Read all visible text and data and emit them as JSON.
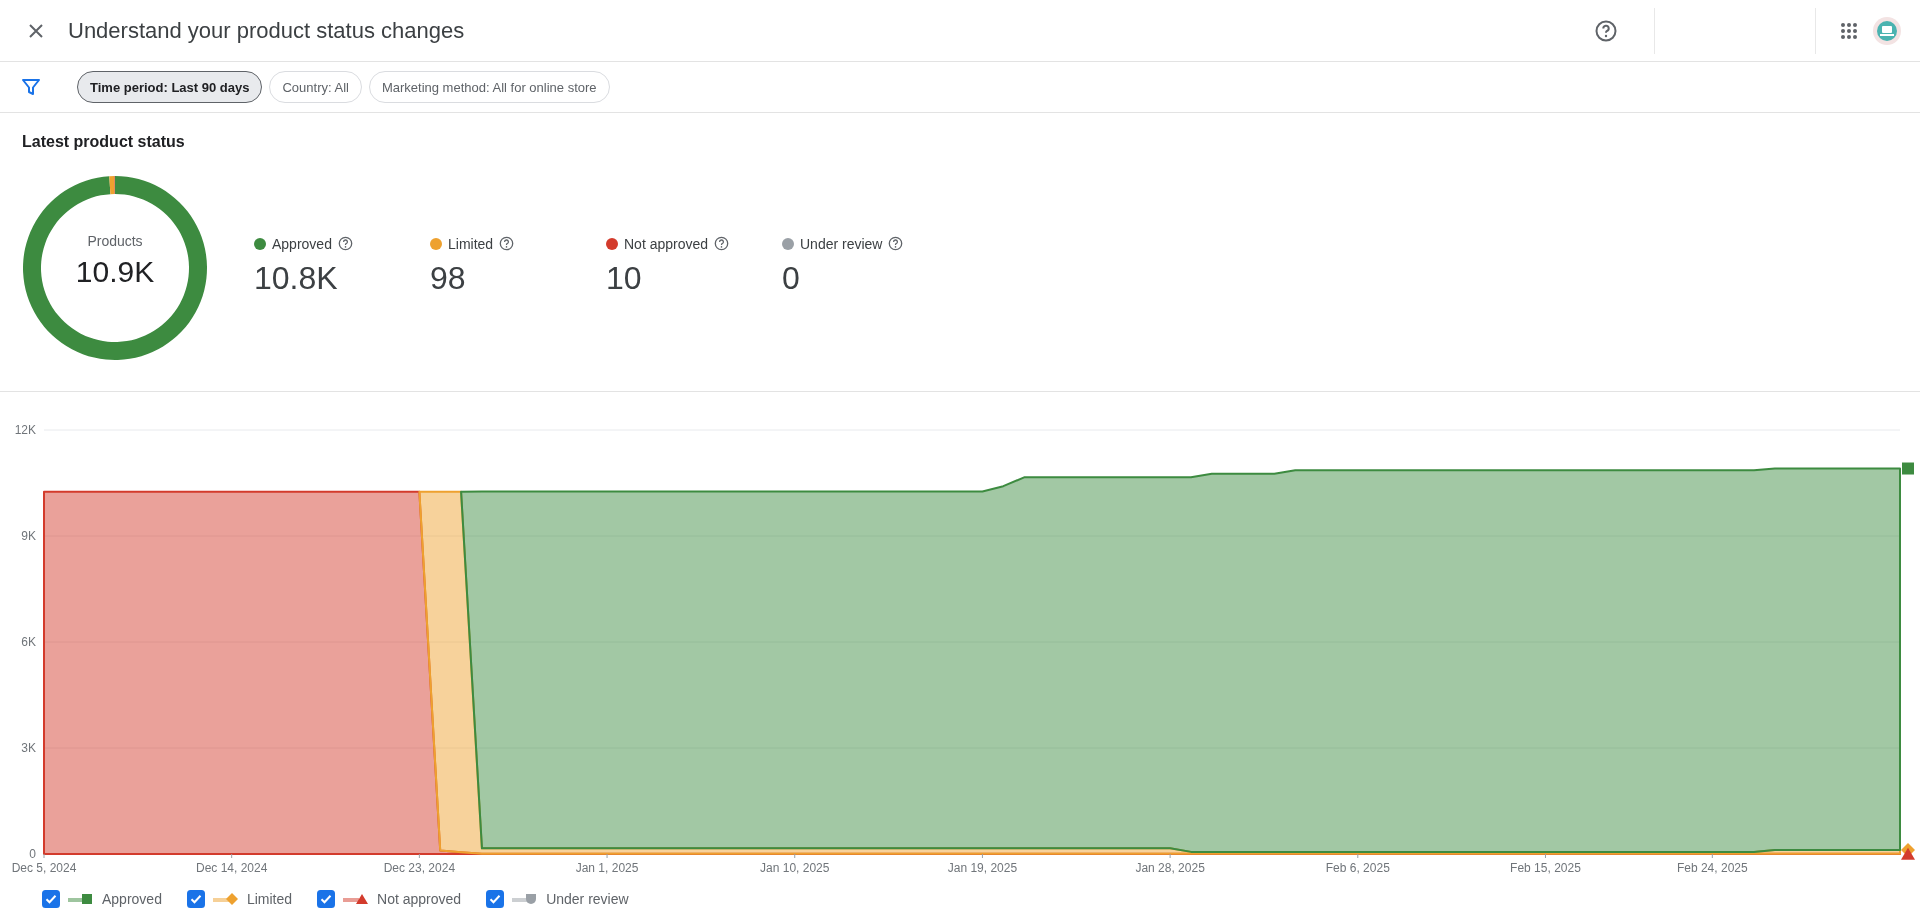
{
  "header": {
    "title": "Understand your product status changes"
  },
  "filters": [
    {
      "label": "Time period: Last 90 days",
      "selected": true
    },
    {
      "label": "Country: All",
      "selected": false
    },
    {
      "label": "Marketing method: All for online store",
      "selected": false
    }
  ],
  "summary": {
    "title": "Latest product status",
    "total_label": "Products",
    "total": "10.9K",
    "chart_data": {
      "type": "donut",
      "categories": [
        "Approved",
        "Limited",
        "Not approved",
        "Under review"
      ],
      "values": [
        99.01,
        0.9,
        0.09,
        0
      ]
    },
    "statuses": [
      {
        "value": "10.8K",
        "color": "#3d8b40"
      },
      {
        "value": "98",
        "color": "#eea12f"
      },
      {
        "value": "10",
        "color": "#d33b2c"
      },
      {
        "value": "0",
        "color": "#9aa0a6"
      }
    ]
  },
  "trend": {
    "chart_data": {
      "type": "area",
      "stacked": true,
      "grid": true,
      "categories": [
        "Dec 5, 2024",
        null,
        null,
        null,
        null,
        null,
        null,
        null,
        null,
        "Dec 14, 2024",
        null,
        null,
        null,
        null,
        null,
        null,
        null,
        null,
        "Dec 23, 2024",
        null,
        null,
        null,
        null,
        null,
        null,
        null,
        null,
        "Jan 1, 2025",
        null,
        null,
        null,
        null,
        null,
        null,
        null,
        null,
        "Jan 10, 2025",
        null,
        null,
        null,
        null,
        null,
        null,
        null,
        null,
        "Jan 19, 2025",
        null,
        null,
        null,
        null,
        null,
        null,
        null,
        null,
        "Jan 28, 2025",
        null,
        null,
        null,
        null,
        null,
        null,
        null,
        null,
        "Feb 6, 2025",
        null,
        null,
        null,
        null,
        null,
        null,
        null,
        null,
        "Feb 15, 2025",
        null,
        null,
        null,
        null,
        null,
        null,
        null,
        "Feb 24, 2025",
        null,
        null,
        null,
        null,
        null,
        null,
        null,
        null,
        null
      ],
      "series": [
        {
          "color": "#d33b2c",
          "values": [
            10250,
            10250,
            10250,
            10250,
            10250,
            10250,
            10250,
            10250,
            10250,
            10250,
            10250,
            10250,
            10250,
            10250,
            10250,
            10250,
            10250,
            10250,
            10250,
            100,
            50,
            10,
            10,
            10,
            10,
            10,
            10,
            10,
            10,
            10,
            10,
            10,
            10,
            10,
            10,
            10,
            10,
            10,
            10,
            10,
            10,
            10,
            10,
            10,
            10,
            10,
            10,
            10,
            10,
            10,
            10,
            10,
            10,
            10,
            10,
            10,
            10,
            10,
            10,
            10,
            10,
            10,
            10,
            10,
            10,
            10,
            10,
            10,
            10,
            10,
            10,
            10,
            10,
            10,
            10,
            10,
            10,
            10,
            10,
            10,
            10,
            10,
            10,
            10,
            10,
            10,
            10,
            10,
            10,
            10
          ]
        },
        {
          "color": "#eea12f",
          "values": [
            null,
            null,
            null,
            null,
            null,
            null,
            null,
            null,
            null,
            null,
            null,
            null,
            null,
            null,
            null,
            null,
            null,
            null,
            0,
            10150,
            10200,
            150,
            150,
            150,
            150,
            150,
            150,
            150,
            150,
            150,
            150,
            150,
            150,
            150,
            150,
            150,
            150,
            150,
            150,
            150,
            150,
            150,
            150,
            150,
            150,
            150,
            150,
            150,
            150,
            150,
            150,
            150,
            150,
            150,
            150,
            50,
            50,
            50,
            50,
            50,
            50,
            50,
            50,
            50,
            50,
            50,
            50,
            50,
            50,
            50,
            50,
            50,
            50,
            50,
            50,
            50,
            50,
            50,
            50,
            50,
            50,
            50,
            50,
            100,
            100,
            100,
            100,
            100,
            100,
            100
          ]
        },
        {
          "color": "#3d8b40",
          "values": [
            null,
            null,
            null,
            null,
            null,
            null,
            null,
            null,
            null,
            null,
            null,
            null,
            null,
            null,
            null,
            null,
            null,
            null,
            null,
            null,
            0,
            10100,
            10100,
            10100,
            10100,
            10100,
            10100,
            10100,
            10100,
            10100,
            10100,
            10100,
            10100,
            10100,
            10100,
            10100,
            10100,
            10100,
            10100,
            10100,
            10100,
            10100,
            10100,
            10100,
            10100,
            10100,
            10250,
            10500,
            10500,
            10500,
            10500,
            10500,
            10500,
            10500,
            10500,
            10600,
            10700,
            10700,
            10700,
            10700,
            10800,
            10800,
            10800,
            10800,
            10800,
            10800,
            10800,
            10800,
            10800,
            10800,
            10800,
            10800,
            10800,
            10800,
            10800,
            10800,
            10800,
            10800,
            10800,
            10800,
            10800,
            10800,
            10800,
            10800,
            10800,
            10800,
            10800,
            10800,
            10800,
            10800
          ]
        }
      ],
      "ylim": [
        0,
        12000
      ],
      "yticks": [
        0,
        {
          "value": 3000,
          "label": "3K"
        },
        {
          "value": 6000,
          "label": "6K"
        },
        {
          "value": 9000,
          "label": "9K"
        },
        {
          "value": 12000,
          "label": "12K"
        }
      ]
    },
    "legend": [
      {
        "label": "Approved",
        "checked": true,
        "kind": "square",
        "color": "#3d8b40"
      },
      {
        "label": "Limited",
        "checked": true,
        "kind": "diamond",
        "color": "#eea12f"
      },
      {
        "label": "Not approved",
        "checked": true,
        "kind": "triangle",
        "color": "#d33b2c"
      },
      {
        "label": "Under review",
        "checked": true,
        "kind": "rounded",
        "color": "#9aa0a6"
      }
    ]
  }
}
